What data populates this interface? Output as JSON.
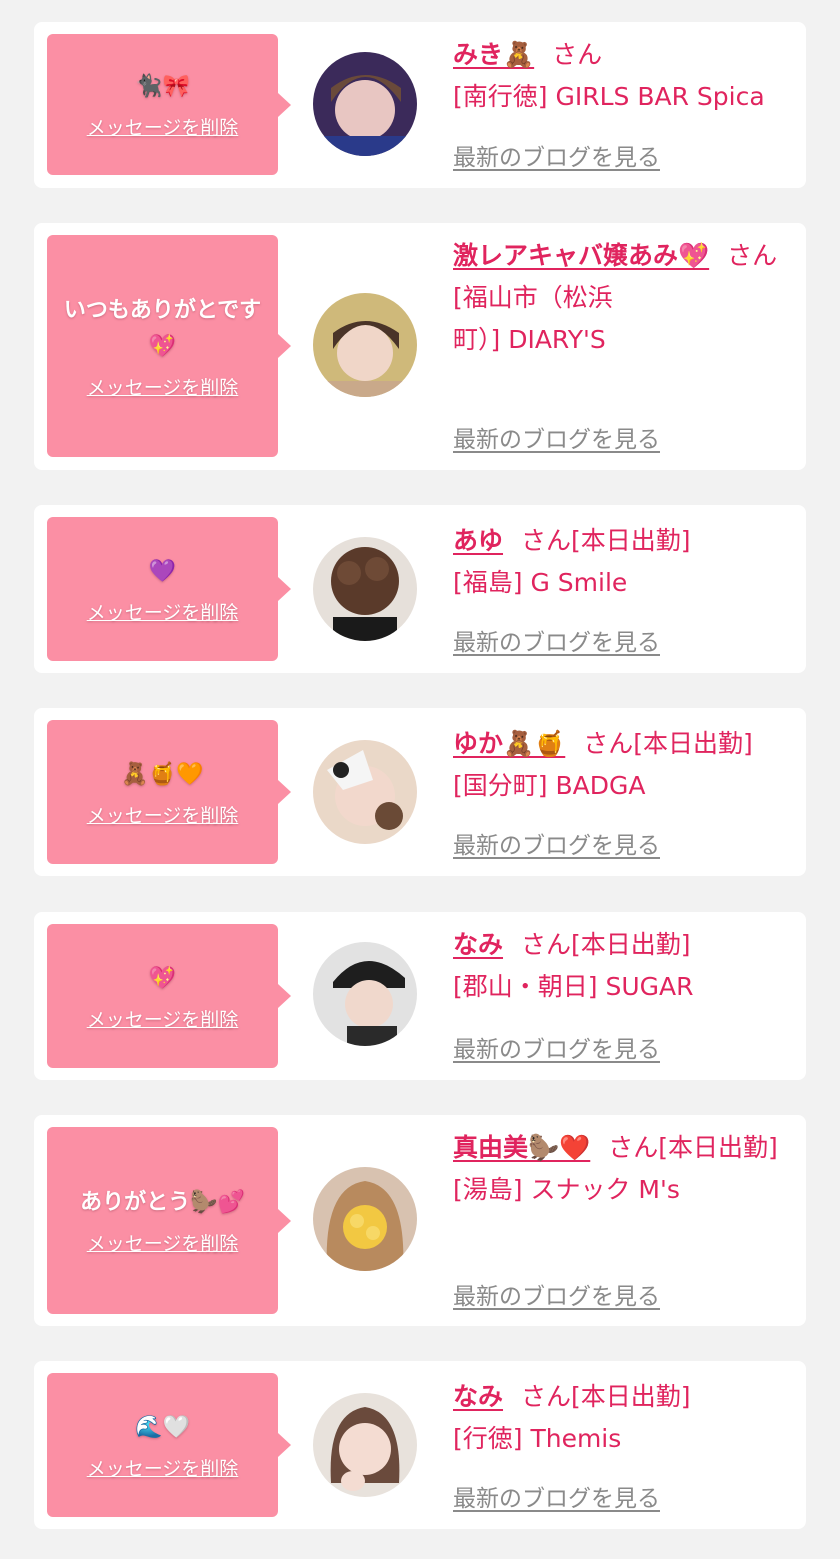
{
  "colors": {
    "background": "#f2f2f2",
    "card": "#ffffff",
    "bubble": "#fb8fa4",
    "accent": "#e0245e",
    "link_gray": "#8a8a8a"
  },
  "messages": [
    {
      "message": "🐈‍⬛🎀",
      "delete_label": "メッセージを削除",
      "name": "みき🧸",
      "san": "さん",
      "badge": "",
      "shop": "[南行徳] GIRLS BAR Spica",
      "blog_label": "最新のブログを見る",
      "avatar_icon": "profile-photo-icon"
    },
    {
      "message": "いつもありがとです💖",
      "delete_label": "メッセージを削除",
      "name": "激レアキャバ嬢あみ💖",
      "san": "さん",
      "badge": "",
      "shop": "[福山市（松浜町）] DIARY'S",
      "blog_label": "最新のブログを見る",
      "avatar_icon": "profile-photo-icon"
    },
    {
      "message": "💜",
      "delete_label": "メッセージを削除",
      "name": "あゆ",
      "san": "さん",
      "badge": "[本日出勤]",
      "shop": "[福島] G Smile",
      "blog_label": "最新のブログを見る",
      "avatar_icon": "profile-photo-icon"
    },
    {
      "message": "🧸🍯🧡",
      "delete_label": "メッセージを削除",
      "name": "ゆか🧸🍯",
      "san": "さん",
      "badge": "[本日出勤]",
      "shop": "[国分町] BADGA",
      "blog_label": "最新のブログを見る",
      "avatar_icon": "profile-photo-icon"
    },
    {
      "message": "💖",
      "delete_label": "メッセージを削除",
      "name": "なみ",
      "san": "さん",
      "badge": "[本日出勤]",
      "shop": "[郡山・朝日] SUGAR",
      "blog_label": "最新のブログを見る",
      "avatar_icon": "profile-photo-icon"
    },
    {
      "message": "ありがとう🦫💕",
      "delete_label": "メッセージを削除",
      "name": "真由美🦫❤️",
      "san": "さん",
      "badge": "[本日出勤]",
      "shop": "[湯島] スナック M's",
      "blog_label": "最新のブログを見る",
      "avatar_icon": "profile-photo-icon"
    },
    {
      "message": "🌊🤍",
      "delete_label": "メッセージを削除",
      "name": "なみ",
      "san": "さん",
      "badge": "[本日出勤]",
      "shop": "[行徳] Themis",
      "blog_label": "最新のブログを見る",
      "avatar_icon": "profile-photo-icon"
    }
  ]
}
